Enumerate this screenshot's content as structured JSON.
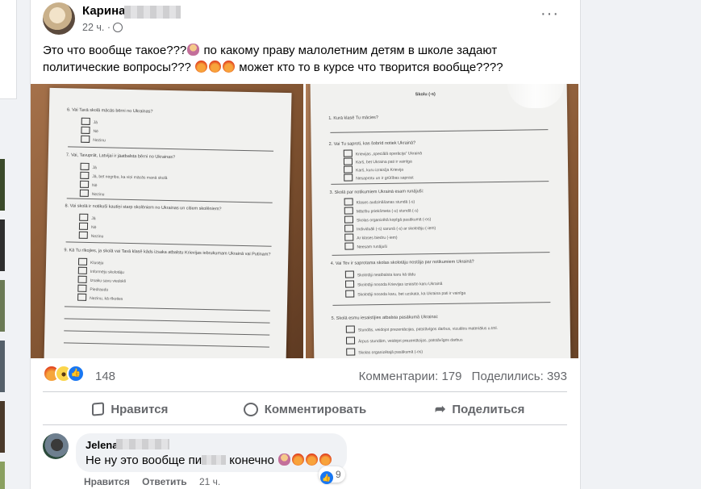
{
  "post": {
    "author": "Карина І",
    "time": "22 ч.",
    "more_label": "···",
    "text_part1": "Это что вообще такое???",
    "text_part2": "по какому праву малолетним детям в школе задают политические вопросы???",
    "text_part3": "может кто то в курсе что творится вообще????",
    "reactions_count": "148",
    "comments_count": "Комментарии: 179",
    "shares_count": "Поделились: 393",
    "actions": {
      "like": "Нравится",
      "comment": "Комментировать",
      "share": "Поделиться"
    },
    "reaction_types": [
      "angry",
      "wow",
      "like"
    ]
  },
  "photos": {
    "left": {
      "q6": "6. Vai Tavā skolā mācās bērni no Ukrainas?",
      "q6_opts": [
        "Jā",
        "Nē",
        "Nezinu"
      ],
      "q7": "7. Vai, Tavuprāt, Latvijai ir jāatbalsta bērni no Ukrainas?",
      "q7_opts": [
        "Jā",
        "Jā, bet negribu, ka viņi mācās manā skolā",
        "Nē",
        "Nezinu"
      ],
      "q8": "8. Vai skolā ir notikuši kautiņi starp skolēniem no Ukrainas un citiem skolēniem?",
      "q8_opts": [
        "Jā",
        "Nē",
        "Nezinu"
      ],
      "q9": "9. Kā Tu rīkojies, ja skolā vai Tavā klasē kāds izsaka atbalstu Krievijas iebrukumam Ukrainā vai Putinam?",
      "q9_opts": [
        "Klusēju",
        "Informēju skolotāju",
        "Izsaku savu viedokli",
        "Piedraudu",
        "Nezinu, kā rīkoties"
      ]
    },
    "right": {
      "header": "Skolu (-s)",
      "q1": "1. Kurā klasē Tu mācies?",
      "q2": "2. Vai Tu saproti, kas šobrīd notiek Ukrainā?",
      "q2_opts": [
        "Krievijas „speciālā operācija” Ukrainā",
        "Karš, bet Ukraina pati ir vainīga",
        "Karš, kuru izraisīja Krievija",
        "Nesaprotu un ir grūtības saprast"
      ],
      "q3": "3. Skolā par notikumiem Ukrainā esam runājuši:",
      "q3_opts": [
        "Klases audzināšanas stundā (-s)",
        "Mācību priekšmeta (-u) stundā (-s)",
        "Skolas organizētā kopīgā pasākumā (-os)",
        "Individuāli (-s) sarunā (-s) ar skolotāju (-iem)",
        "Ar klases biedru (-iem)",
        "Neesam runājuši"
      ],
      "q4": "4. Vai Tev ir saprotama skolas skolotāju nostāja par notikumiem Ukrainā?",
      "q4_opts": [
        "Skolotāji neatbalsta karu kā tādu",
        "Skolotāji nosoda Krievijas izraisīto karu Ukrainā",
        "Skolotāji nosoda karu, bet uzskata, ka Ukraina pati ir vainīga"
      ],
      "q5": "5. Skolā esmu iesaistījies atbalsta pasākumā Ukrainai:",
      "q5_opts": [
        "Stundās, veidojot prezentācijas, patstāvīgos darbus, vizuālos materiālus u.tml.",
        "Ārpus stundām, veidojot prezentācijas, patstāvīgos darbus",
        "Skolas organizētajā pasākumā (-os)"
      ]
    }
  },
  "comment": {
    "author": "Jelena",
    "text_start": "Не ну это вообще пи",
    "text_end": "конечно",
    "reaction_count": "9",
    "like_label": "Нравится",
    "reply_label": "Ответить",
    "time": "21 ч."
  },
  "colors": {
    "accent": "#1877f2",
    "secondary_text": "#65676b",
    "primary_text": "#050505",
    "background": "#f0f2f5"
  },
  "icons": [
    "globe-icon",
    "more-icon",
    "like-icon",
    "comment-icon",
    "share-icon"
  ]
}
